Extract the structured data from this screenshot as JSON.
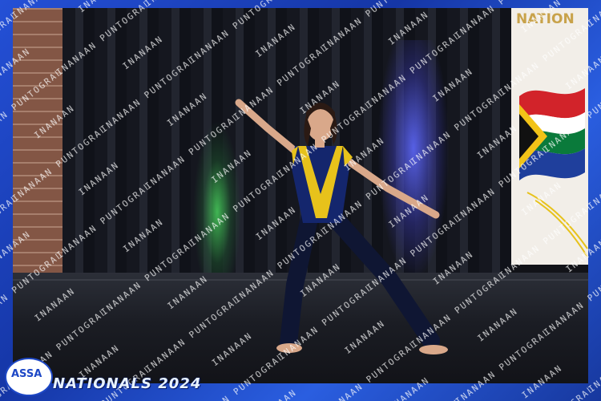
{
  "event": {
    "title": "NATIONALS 2024"
  },
  "banner": {
    "text": "NATION"
  },
  "logo": {
    "text": "ASSA"
  },
  "watermark": {
    "text": "INANAAN PUNTOGRAPHY"
  },
  "colors": {
    "frame_blue": "#1f43b8",
    "costume_blue": "#14266d",
    "costume_yellow": "#e7c21b",
    "legging_navy": "#0f1633"
  }
}
